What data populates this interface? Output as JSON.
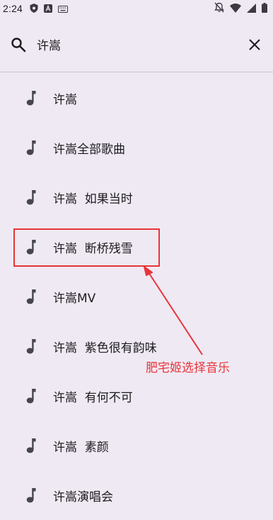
{
  "status_bar": {
    "time": "2:24",
    "icons": [
      "shield-icon",
      "a-icon",
      "keyboard-icon",
      "mute-icon",
      "wifi-icon",
      "signal-icon",
      "battery-icon"
    ]
  },
  "search": {
    "query": "许嵩",
    "icons": [
      "search-icon",
      "close-icon"
    ]
  },
  "suggestions": [
    {
      "label": "许嵩"
    },
    {
      "label": "许嵩全部歌曲"
    },
    {
      "label": "许嵩  如果当时"
    },
    {
      "label": "许嵩  断桥残雪"
    },
    {
      "label": "许嵩MV"
    },
    {
      "label": "许嵩  紫色很有韵味"
    },
    {
      "label": "许嵩  有何不可"
    },
    {
      "label": "许嵩  素颜"
    },
    {
      "label": "许嵩演唱会"
    }
  ],
  "annotation": {
    "text": "肥宅姬选择音乐",
    "color": "#e8343a"
  }
}
